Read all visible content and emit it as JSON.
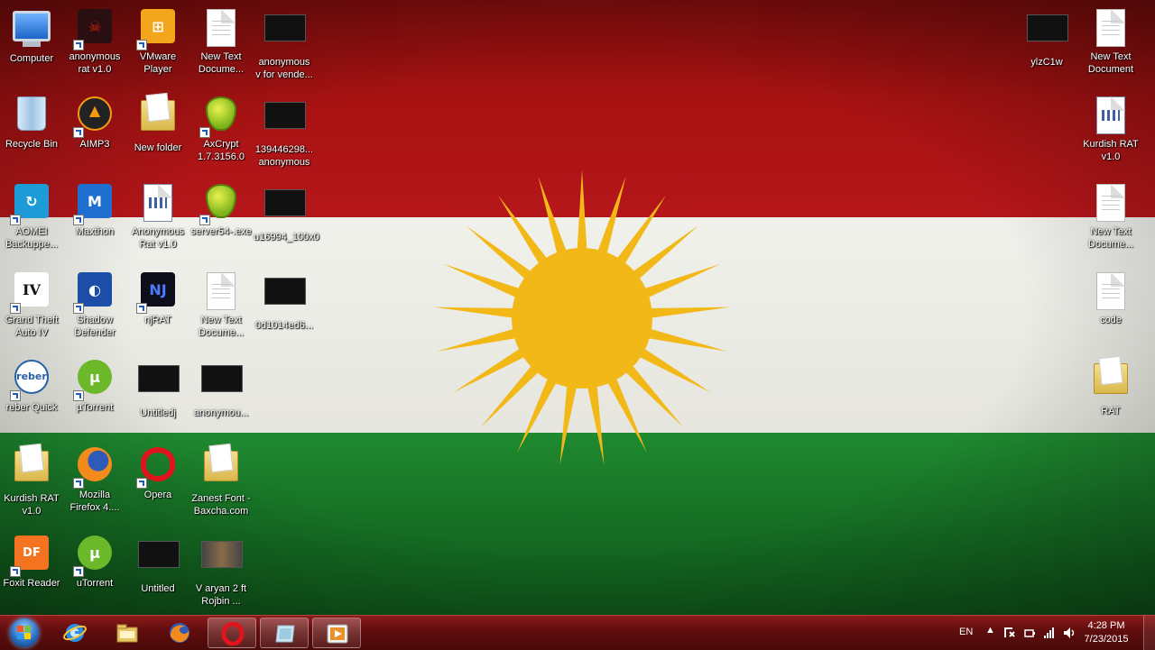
{
  "wallpaper": {
    "colors": {
      "red": "#b5161a",
      "white": "#eeeeea",
      "green": "#17782a",
      "sun": "#f2b818"
    }
  },
  "desktop_icons_left": [
    {
      "label": "Computer",
      "icon": "computer-icon"
    },
    {
      "label": "anonymous\nrat v1.0",
      "icon": "anonymous-rat-icon"
    },
    {
      "label": "VMware\nPlayer",
      "icon": "vmware-icon"
    },
    {
      "label": "New Text\nDocume...",
      "icon": "text-document-icon"
    },
    {
      "label": "anonymous\nv for vende...",
      "icon": "image-thumbnail-icon"
    },
    {
      "label": "Recycle Bin",
      "icon": "recycle-bin-icon"
    },
    {
      "label": "AIMP3",
      "icon": "aimp-icon"
    },
    {
      "label": "New folder",
      "icon": "folder-icon"
    },
    {
      "label": "AxCrypt\n1.7.3156.0",
      "icon": "axcrypt-icon"
    },
    {
      "label": "139446298...\nanonymous",
      "icon": "image-thumbnail-icon"
    },
    {
      "label": "AOMEI\nBackuppe...",
      "icon": "aomei-icon"
    },
    {
      "label": "Maxthon",
      "icon": "maxthon-icon"
    },
    {
      "label": "Anonymous\nRat v1.0",
      "icon": "application-icon"
    },
    {
      "label": "server54-.exe",
      "icon": "axcrypt-icon"
    },
    {
      "label": "u16994_100x0",
      "icon": "image-thumbnail-icon"
    },
    {
      "label": "Grand Theft\nAuto IV",
      "icon": "gta-icon"
    },
    {
      "label": "Shadow\nDefender",
      "icon": "shadow-defender-icon"
    },
    {
      "label": "njRAT",
      "icon": "njrat-icon"
    },
    {
      "label": "New Text\nDocume...",
      "icon": "text-document-icon"
    },
    {
      "label": "0d1014ed6...",
      "icon": "image-thumbnail-icon"
    },
    {
      "label": "reber Quick",
      "icon": "reber-icon"
    },
    {
      "label": "µTorrent",
      "icon": "utorrent-icon"
    },
    {
      "label": "Untitledj",
      "icon": "image-thumbnail-icon"
    },
    {
      "label": "anonymou...",
      "icon": "image-thumbnail-icon"
    },
    {
      "label": "Kurdish RAT\nv1.0",
      "icon": "folder-icon"
    },
    {
      "label": "Mozilla\nFirefox 4....",
      "icon": "firefox-icon"
    },
    {
      "label": "Opera",
      "icon": "opera-icon"
    },
    {
      "label": "Zanest Font -\nBaxcha.com",
      "icon": "folder-icon"
    },
    {
      "label": "Foxit Reader",
      "icon": "foxit-reader-icon"
    },
    {
      "label": "uTorrent",
      "icon": "utorrent-icon"
    },
    {
      "label": "Untitled",
      "icon": "image-thumbnail-icon"
    },
    {
      "label": "V aryan 2 ft\nRojbin ...",
      "icon": "video-file-icon"
    }
  ],
  "desktop_icons_right": [
    {
      "label": "ylzC1w",
      "icon": "image-thumbnail-icon"
    },
    {
      "label": "New Text\nDocument",
      "icon": "text-document-icon"
    },
    {
      "label": "Kurdish RAT\nv1.0",
      "icon": "application-icon"
    },
    {
      "label": "New Text\nDocume...",
      "icon": "text-document-icon"
    },
    {
      "label": "code",
      "icon": "text-document-icon"
    },
    {
      "label": "RAT",
      "icon": "folder-icon"
    }
  ],
  "taskbar": {
    "start_icon": "windows-start-icon",
    "pinned": [
      {
        "name": "internet-explorer-icon"
      },
      {
        "name": "file-explorer-icon"
      },
      {
        "name": "firefox-icon"
      },
      {
        "name": "opera-icon"
      },
      {
        "name": "window-icon"
      },
      {
        "name": "media-player-icon"
      }
    ],
    "language": "EN",
    "time": "4:28 PM",
    "date": "7/23/2015"
  }
}
